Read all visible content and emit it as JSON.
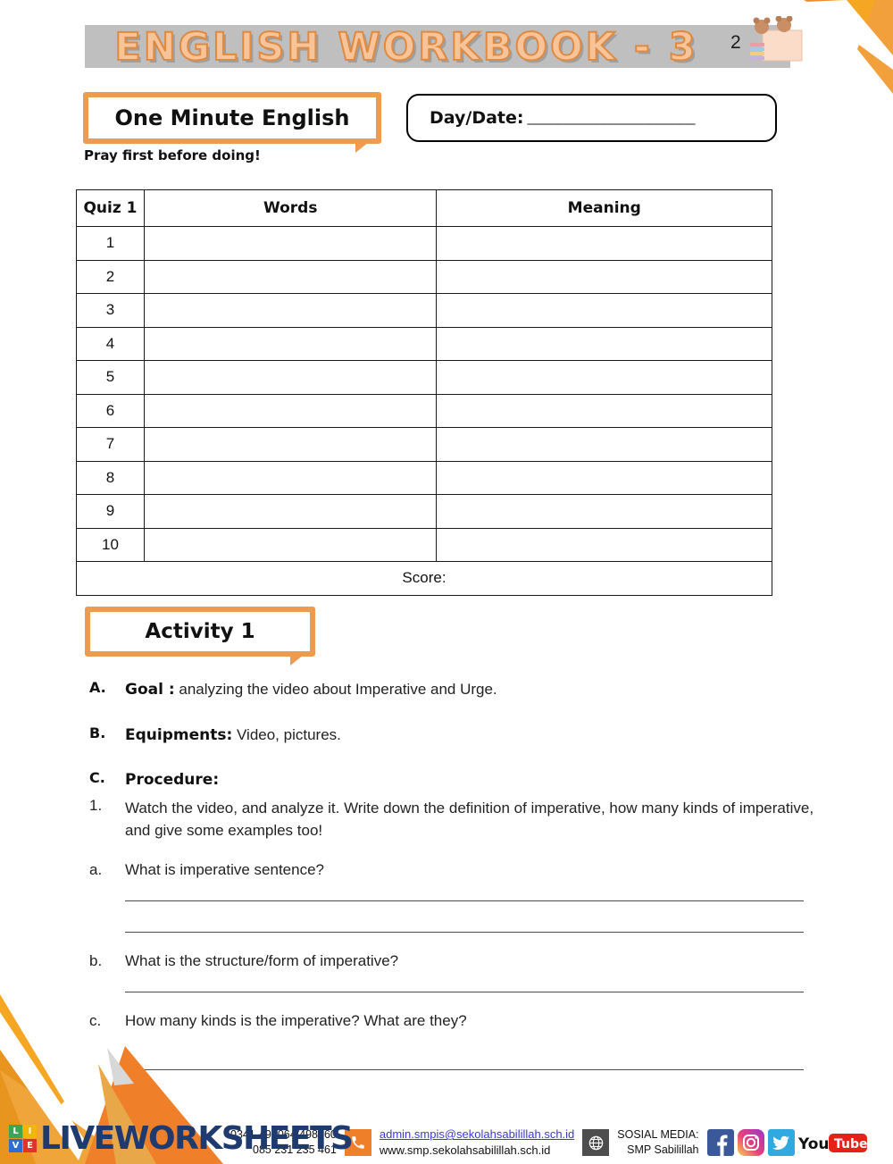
{
  "header": {
    "title": "ENGLISH WORKBOOK - 3",
    "page_number": "2",
    "bear_art_name": "teddy-bear-books-illustration",
    "band_color": "#bfbfbf",
    "title_fill": "#f7c49a",
    "title_outline": "#e08a40"
  },
  "accent_color": "#ed9b4f",
  "one_minute": {
    "label": "One Minute English",
    "note": "Pray first before doing!"
  },
  "daydate": {
    "label": "Day/Date:",
    "line": "______________________"
  },
  "quiz": {
    "headers": [
      "Quiz 1",
      "Words",
      "Meaning"
    ],
    "rows": [
      {
        "no": "1",
        "words": "",
        "meaning": ""
      },
      {
        "no": "2",
        "words": "",
        "meaning": ""
      },
      {
        "no": "3",
        "words": "",
        "meaning": ""
      },
      {
        "no": "4",
        "words": "",
        "meaning": ""
      },
      {
        "no": "5",
        "words": "",
        "meaning": ""
      },
      {
        "no": "6",
        "words": "",
        "meaning": ""
      },
      {
        "no": "7",
        "words": "",
        "meaning": ""
      },
      {
        "no": "8",
        "words": "",
        "meaning": ""
      },
      {
        "no": "9",
        "words": "",
        "meaning": ""
      },
      {
        "no": "10",
        "words": "",
        "meaning": ""
      }
    ],
    "score_label": "Score:"
  },
  "activity": {
    "label": "Activity 1",
    "goal": {
      "marker": "A.",
      "title": "Goal :",
      "text": " analyzing the video about Imperative and Urge."
    },
    "equipments": {
      "marker": "B.",
      "title": "Equipments:",
      "text": " Video, pictures."
    },
    "procedure": {
      "marker": "C.",
      "title": "Procedure:",
      "item1_marker": "1.",
      "item1_text": "Watch the video, and analyze it. Write down the definition of imperative, how many kinds of imperative, and give some examples too!"
    },
    "questions": [
      {
        "marker": "a.",
        "text": "What is imperative sentence?"
      },
      {
        "marker": "b.",
        "text": "What is the structure/form of imperative?"
      },
      {
        "marker": "c.",
        "text": "How many kinds is the imperative? What are they?"
      }
    ]
  },
  "footer": {
    "phone1": "0341-495064/498560",
    "phone2": "085 231 235 461",
    "email": "admin.smpis@sekolahsabilillah.sch.id",
    "website": "www.smp.sekolahsabilillah.sch.id",
    "social_label": "SOSIAL MEDIA:",
    "social_name": "SMP Sabilillah",
    "socials": [
      "facebook-icon",
      "instagram-icon",
      "twitter-icon",
      "youtube-icon"
    ],
    "watermark": "LIVEWORKSHEETS",
    "watermark_cells": [
      "L",
      "I",
      "V",
      "E"
    ],
    "watermark_cell_colors": [
      "#3aa757",
      "#f2b705",
      "#2d6fd1",
      "#e0342b"
    ]
  }
}
